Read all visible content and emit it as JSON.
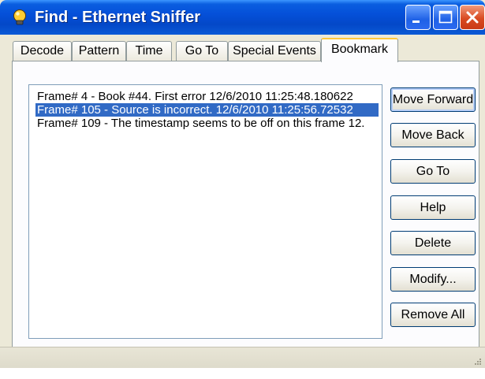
{
  "window": {
    "title": "Find - Ethernet Sniffer",
    "title_color": "#ffffff",
    "titlebar_color": "#0550d9",
    "icon": "bulb-icon"
  },
  "tabs": [
    {
      "label": "Decode"
    },
    {
      "label": "Pattern"
    },
    {
      "label": "Time"
    },
    {
      "label": "Go To"
    },
    {
      "label": "Special Events"
    },
    {
      "label": "Bookmark"
    }
  ],
  "active_tab": "Bookmark",
  "bookmarks": {
    "items": [
      {
        "text": "Frame# 4 - Book #44.  First error  12/6/2010 11:25:48.180622"
      },
      {
        "text": "Frame# 105 - Source is incorrect.  12/6/2010 11:25:56.72532"
      },
      {
        "text": "Frame# 109 - The timestamp seems to be off on this frame  12."
      }
    ],
    "selected_index": 1,
    "selection_color": "#316ac5"
  },
  "buttons": {
    "move_forward": "Move Forward",
    "move_back": "Move Back",
    "go_to": "Go To",
    "help": "Help",
    "delete": "Delete",
    "modify": "Modify...",
    "remove_all": "Remove All"
  }
}
